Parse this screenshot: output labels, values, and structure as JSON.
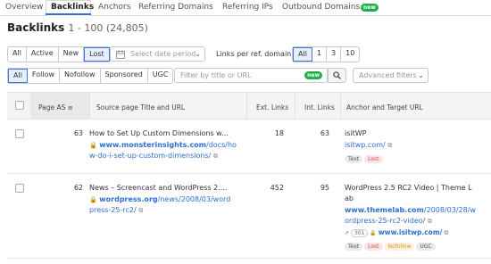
{
  "tabs": [
    "Overview",
    "Backlinks",
    "Anchors",
    "Referring Domains",
    "Referring IPs",
    "Outbound Domains"
  ],
  "tabs_new_badge": "new",
  "header": {
    "title": "Backlinks",
    "range": "1 - 100 (24,805)"
  },
  "filters1": {
    "options": [
      "All",
      "Active",
      "New",
      "Lost"
    ],
    "selected": "Lost"
  },
  "date": {
    "placeholder": "Select date period"
  },
  "per_domain": {
    "label": "Links per ref. domain",
    "options": [
      "All",
      "1",
      "3",
      "10"
    ],
    "selected": "All"
  },
  "filters2": {
    "options": [
      "All",
      "Follow",
      "Nofollow",
      "Sponsored",
      "UGC"
    ],
    "selected": "All"
  },
  "search": {
    "placeholder": "Filter by title or URL",
    "badge": "new"
  },
  "advanced": {
    "label": "Advanced filters"
  },
  "columns": [
    "Page AS",
    "Source page Title and URL",
    "Ext. Links",
    "Int. Links",
    "Anchor and Target URL"
  ],
  "rows": [
    {
      "page_as": "63",
      "title": "How to Set Up Custom Dimensions w...",
      "url_bold": "www.monsterinsights.com",
      "url_rest1": "/docs/ho",
      "url_line2": "w-do-i-set-up-custom-dimensions/",
      "ext_links": "18",
      "int_links": "63",
      "anchor": "isitWP",
      "target": "isitwp.com/",
      "tags": [
        "Text",
        "Lost"
      ]
    },
    {
      "page_as": "62",
      "title": "News – Screencast and WordPress 2....",
      "url_bold": "wordpress.org",
      "url_rest1": "/news/2008/03/word",
      "url_line2": "press-25-rc2/",
      "ext_links": "452",
      "int_links": "95",
      "anchor_line1": "WordPress 2.5 RC2 Video | Theme L",
      "anchor_line2": "ab",
      "target_bold": "www.themelab.com",
      "target_rest1": "/2008/03/28/w",
      "target_line2": "ordpress-25-rc2-video/",
      "redirect_code": "301",
      "redirect_target": "www.isitwp.com/",
      "tags": [
        "Text",
        "Lost",
        "Nofollow",
        "UGC"
      ]
    }
  ],
  "colors": {
    "accent": "#2c6fcf",
    "new_badge": "#22b04f",
    "lost": "#d9534f"
  }
}
